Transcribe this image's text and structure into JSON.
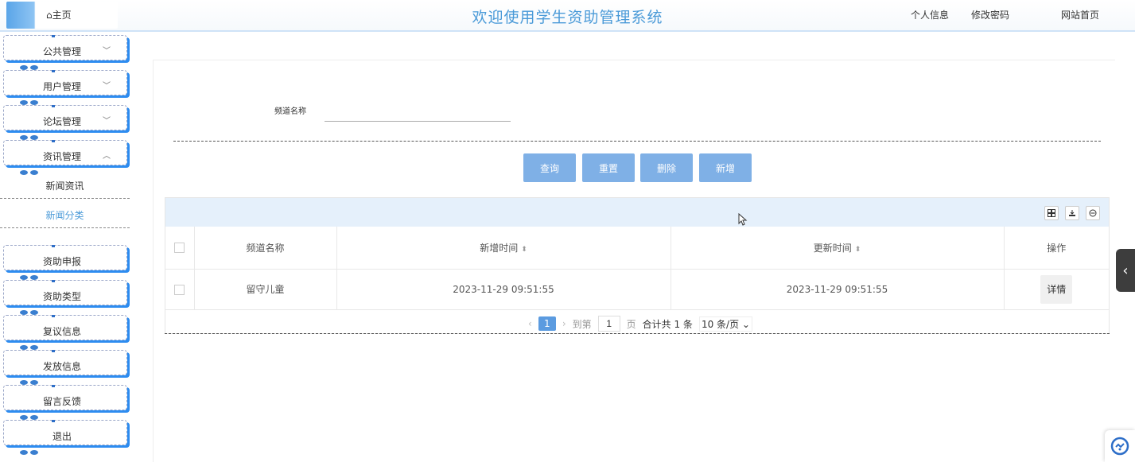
{
  "header": {
    "home_label": "主页",
    "title": "欢迎使用学生资助管理系统",
    "links": [
      "个人信息",
      "修改密码",
      "网站首页"
    ]
  },
  "sidebar": {
    "groups_top": [
      {
        "label": "公共管理",
        "expanded": false
      },
      {
        "label": "用户管理",
        "expanded": false
      },
      {
        "label": "论坛管理",
        "expanded": false
      },
      {
        "label": "资讯管理",
        "expanded": true
      }
    ],
    "sub_items": [
      {
        "label": "新闻资讯",
        "active": false
      },
      {
        "label": "新闻分类",
        "active": true
      }
    ],
    "groups_bottom": [
      "资助申报",
      "资助类型",
      "复议信息",
      "发放信息",
      "留言反馈",
      "退出"
    ]
  },
  "search": {
    "label": "频道名称",
    "value": ""
  },
  "actions": {
    "query": "查询",
    "reset": "重置",
    "delete": "删除",
    "add": "新增"
  },
  "table": {
    "columns": [
      "频道名称",
      "新增时间",
      "更新时间",
      "操作"
    ],
    "rows": [
      {
        "name": "留守儿童",
        "created": "2023-11-29 09:51:55",
        "updated": "2023-11-29 09:51:55",
        "action": "详情"
      }
    ]
  },
  "pager": {
    "current_page": "1",
    "goto_prefix": "到第",
    "goto_value": "1",
    "goto_suffix": "页",
    "total_text": "合计共 1 条",
    "page_size": "10 条/页"
  },
  "colors": {
    "accent": "#4a9ad8",
    "button": "#7fb0e6",
    "toolbar_bg": "#e5f0fb",
    "sidebar_shadow": "#2d8cf0"
  }
}
